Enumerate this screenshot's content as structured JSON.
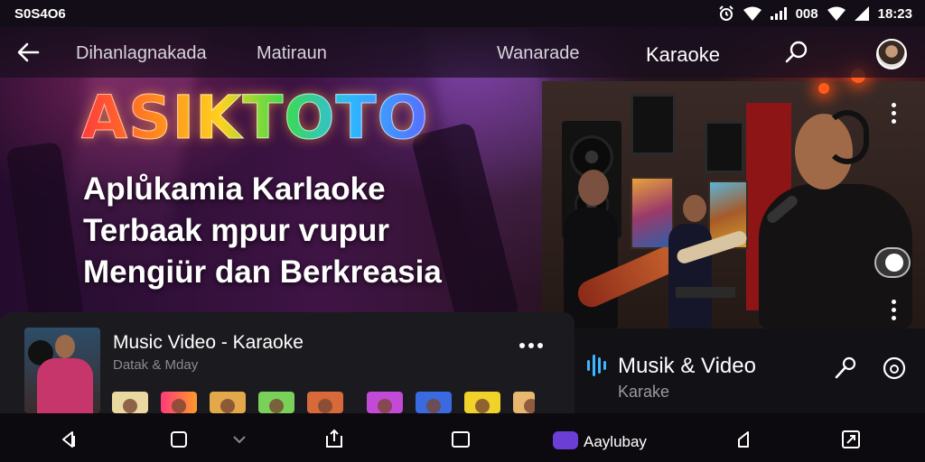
{
  "status_bar": {
    "left_text": "S0S4O6",
    "network_text": "008",
    "time": "18:23",
    "icons": [
      "alarm-icon",
      "wifi-icon",
      "signal-icon",
      "battery-icon"
    ]
  },
  "top_nav": {
    "links": [
      "Dihanlagnakada",
      "Matiraun",
      "Wanarade",
      "Karaoke"
    ],
    "active": "Karaoke",
    "icons": [
      "back-arrow-icon",
      "search-icon",
      "avatar"
    ]
  },
  "hero": {
    "brand": "ASIKTOTO",
    "lines": [
      "Aplůkamia Karlaoke",
      "Terbaak ɱpur ѵupur",
      "Mengiür dan Berkreasia"
    ]
  },
  "music_card": {
    "title": "Music Video - Karaoke",
    "subtitle": "Datak & Mday"
  },
  "right_panel": {
    "title": "Musik & Video",
    "subtitle": "Karake",
    "icons": [
      "equalizer-icon",
      "microphone-icon",
      "info-icon"
    ]
  },
  "bottom_nav": {
    "label": "Aaylubay",
    "icons": [
      "back-icon",
      "square-icon",
      "chevron-down-icon",
      "share-icon",
      "stop-icon",
      "app-icon",
      "home-icon",
      "window-icon"
    ]
  },
  "colors": {
    "accent": "#3fb6ff",
    "pill": "#6b3fd6",
    "background": "#120c16"
  }
}
